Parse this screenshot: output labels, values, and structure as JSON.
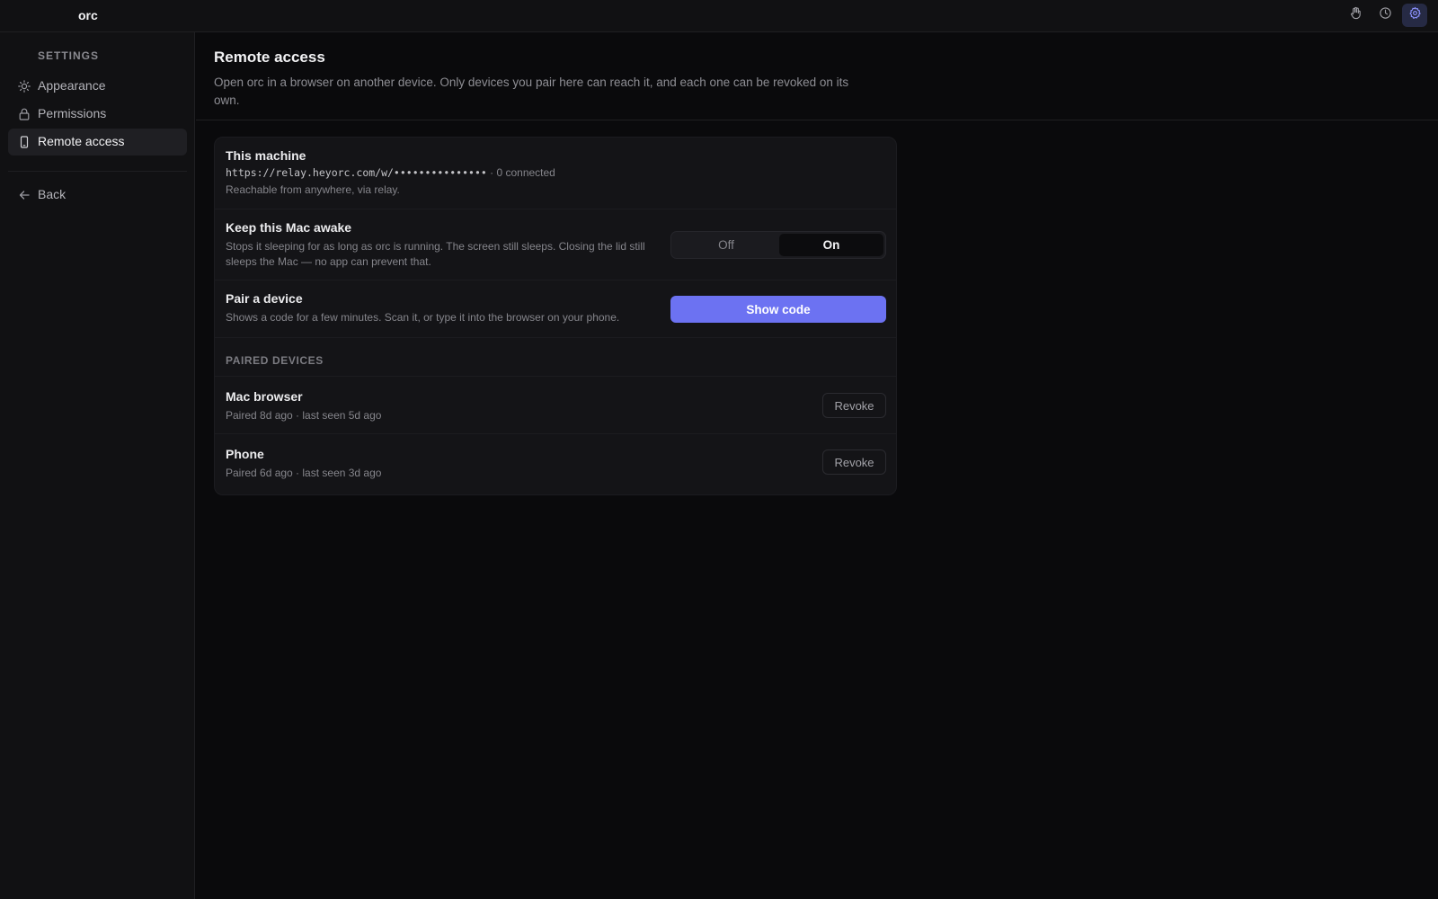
{
  "app": {
    "name": "orc"
  },
  "titlebar": {
    "icons": [
      "hand-icon",
      "clock-icon",
      "gear-icon"
    ],
    "accent": "#6c72f2"
  },
  "sidebar": {
    "heading": "SETTINGS",
    "items": [
      {
        "label": "Appearance",
        "icon": "sun-icon"
      },
      {
        "label": "Permissions",
        "icon": "lock-icon"
      },
      {
        "label": "Remote access",
        "icon": "phone-icon",
        "active": true
      }
    ],
    "back_label": "Back"
  },
  "page": {
    "title": "Remote access",
    "description": "Open orc in a browser on another device. Only devices you pair here can reach it, and each one can be revoked on its own."
  },
  "machine": {
    "title": "This machine",
    "url": "https://relay.heyorc.com/w/•••••••••••••••",
    "connected": "· 0 connected",
    "reachable": "Reachable from anywhere, via relay."
  },
  "awake": {
    "title": "Keep this Mac awake",
    "description": "Stops it sleeping for as long as orc is running. The screen still sleeps. Closing the lid still sleeps the Mac — no app can prevent that.",
    "off_label": "Off",
    "on_label": "On",
    "selected": "On"
  },
  "pair": {
    "title": "Pair a device",
    "description": "Shows a code for a few minutes. Scan it, or type it into the browser on your phone.",
    "button_label": "Show code"
  },
  "paired": {
    "heading": "PAIRED DEVICES",
    "devices": [
      {
        "name": "Mac browser",
        "meta": "Paired 8d ago · last seen 5d ago",
        "action": "Revoke"
      },
      {
        "name": "Phone",
        "meta": "Paired 6d ago · last seen 3d ago",
        "action": "Revoke"
      }
    ]
  }
}
